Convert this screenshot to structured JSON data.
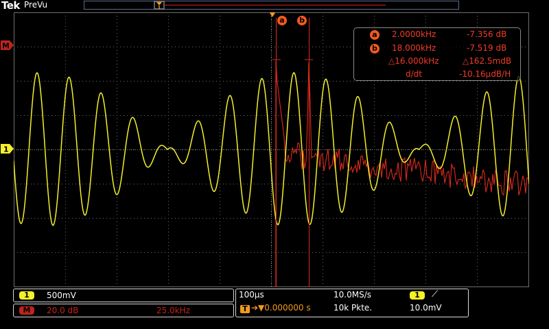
{
  "header": {
    "brand": "Tek",
    "status": "PreVu"
  },
  "markers": {
    "ch1": "1",
    "math": "M"
  },
  "cursors": {
    "a": "a",
    "b": "b"
  },
  "measurements": {
    "a_label": "a",
    "a_freq": "2.0000kHz",
    "a_val": "-7.356 dB",
    "b_label": "b",
    "b_freq": "18.000kHz",
    "b_val": "-7.519 dB",
    "delta_freq": "△16.000kHz",
    "delta_val": "△162.5mdB",
    "rate_label": "d/dt",
    "rate_val": "-10.16μdB/H"
  },
  "bottom": {
    "ch1_badge": "1",
    "ch1_scale": "500mV",
    "math_badge": "M",
    "math_scale": "20.0 dB",
    "math_freq": "25.0kHz",
    "timebase": "100μs",
    "sample_rate": "10.0MS/s",
    "trig_badge": "1",
    "trig_slope": "⟋",
    "trig_badge_t": "T",
    "trig_delay": "➔▼0.000000 s",
    "record_length": "10k Pkte.",
    "trig_level": "10.0mV"
  },
  "colors": {
    "ch1": "#f4f02a",
    "math": "#e02a1f",
    "grid": "#6e6e6e",
    "bg": "#000000"
  }
}
